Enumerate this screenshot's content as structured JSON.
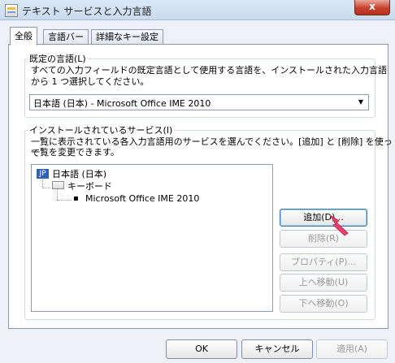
{
  "window": {
    "title": "テキスト サービスと入力言語",
    "close_symbol": "x"
  },
  "tabs": [
    {
      "label": "全般"
    },
    {
      "label": "言語バー"
    },
    {
      "label": "詳細なキー設定"
    }
  ],
  "default_language": {
    "legend": "既定の言語(L)",
    "description_line1": "すべての入力フィールドの既定言語として使用する言語を、インストールされた入力言語",
    "description_line2": "から 1 つ選択してください。",
    "selected": "日本語 (日本) - Microsoft Office IME 2010",
    "arrow": "▼"
  },
  "installed_services": {
    "legend": "インストールされているサービス(I)",
    "description_line1": "一覧に表示されている各入力言語用のサービスを選んでください。[追加] と [削除] を使って",
    "description_line2": "一覧を変更できます。",
    "tree": {
      "language_badge": "JP",
      "language": "日本語 (日本)",
      "category": "キーボード",
      "item_bullet": "▪",
      "item": "Microsoft Office IME 2010"
    },
    "buttons": {
      "add": "追加(D)...",
      "remove": "削除(R)",
      "properties": "プロパティ(P)...",
      "move_up": "上へ移動(U)",
      "move_down": "下へ移動(O)"
    }
  },
  "footer": {
    "ok": "OK",
    "cancel": "キャンセル",
    "apply": "適用(A)"
  }
}
